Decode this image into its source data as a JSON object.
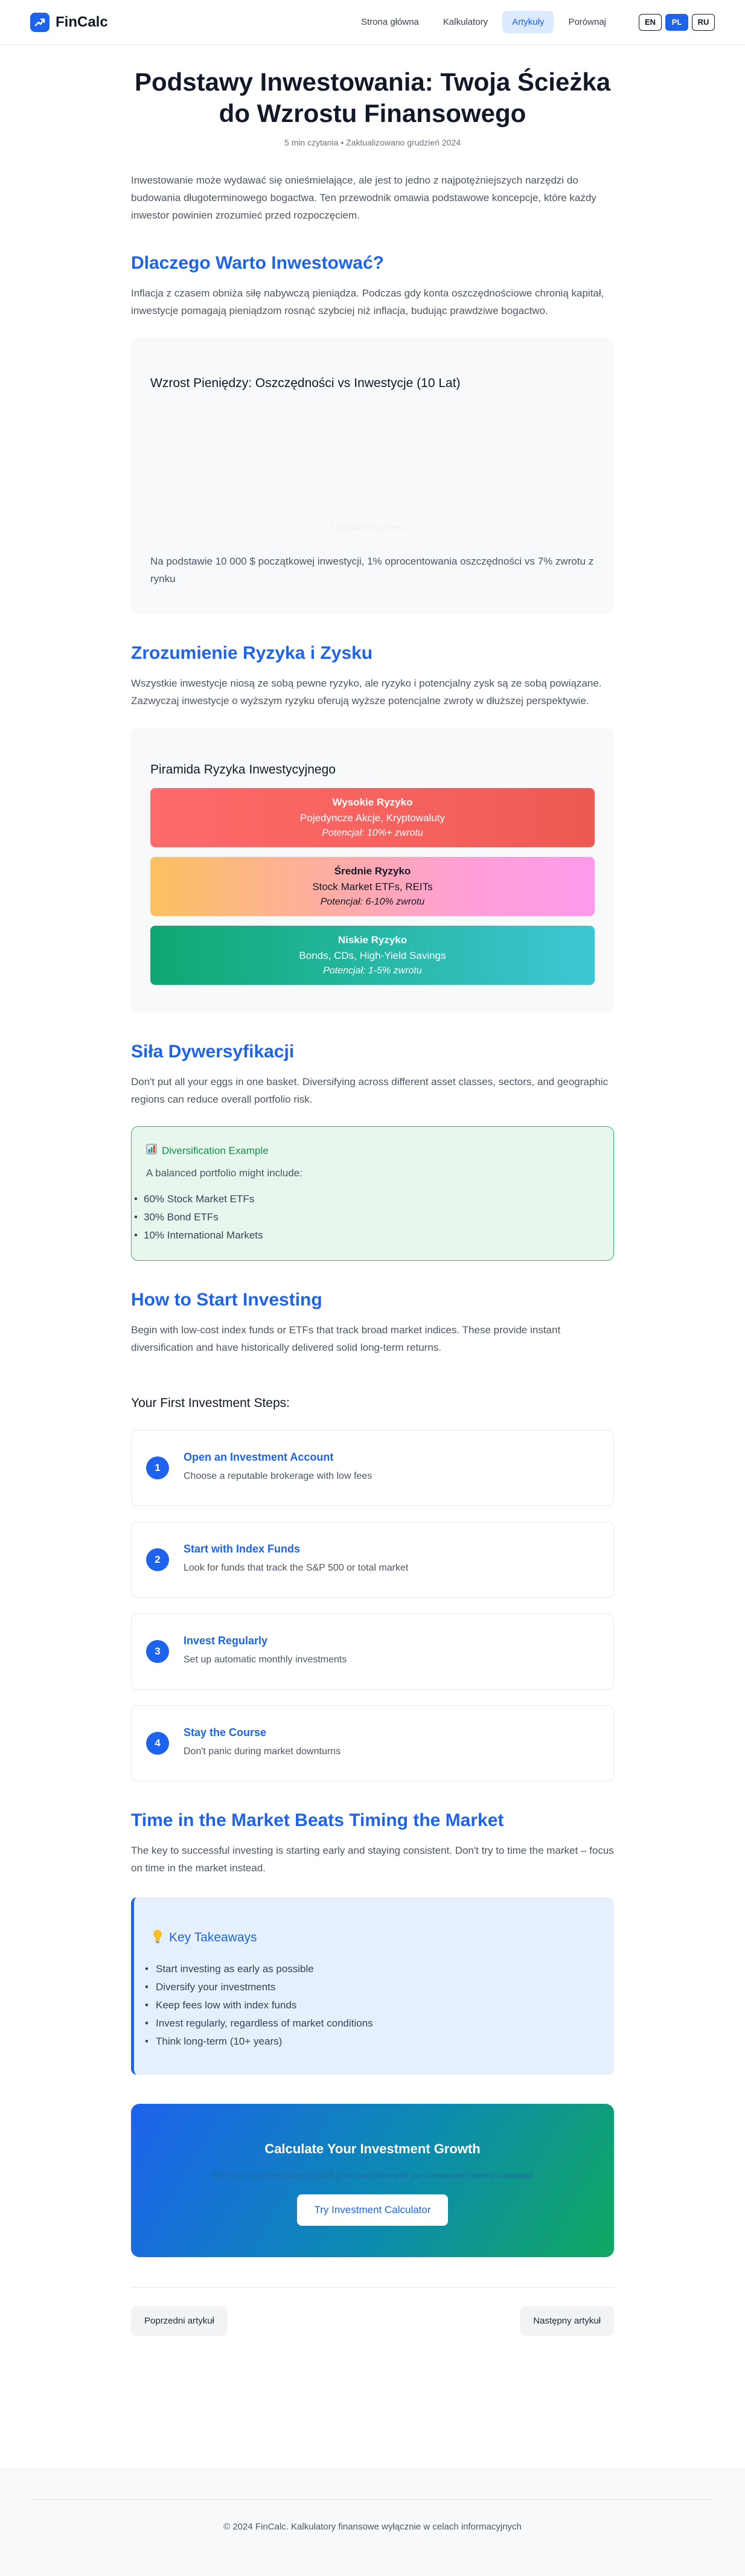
{
  "header": {
    "brand": "FinCalc",
    "nav": [
      {
        "label": "Strona główna"
      },
      {
        "label": "Kalkulatory"
      },
      {
        "label": "Artykuły"
      },
      {
        "label": "Porównaj"
      }
    ],
    "active_nav": "Artykuły",
    "languages": [
      "EN",
      "PL",
      "RU"
    ],
    "active_language": "PL"
  },
  "article": {
    "title": "Podstawy Inwestowania: Twoja Ścieżka do Wzrostu Finansowego",
    "meta": "5 min czytania • Zaktualizowano grudzień 2024",
    "intro": "Inwestowanie może wydawać się onieśmielające, ale jest to jedno z najpotężniejszych narzędzi do budowania długoterminowego bogactwa. Ten przewodnik omawia podstawowe koncepcje, które każdy inwestor powinien zrozumieć przed rozpoczęciem.",
    "why": {
      "heading": "Dlaczego Warto Inwestować?",
      "body": "Inflacja z czasem obniża siłę nabywczą pieniądza. Podczas gdy konta oszczędnościowe chronią kapitał, inwestycje pomagają pieniądzom rosnąć szybciej niż inflacja, budując prawdziwe bogactwo.",
      "chart_title": "Wzrost Pieniędzy: Oszczędności vs Inwestycje (10 Lat)",
      "chart_placeholder": "Ładowanie wykresu...",
      "chart_note": "Na podstawie 10 000 $ początkowej inwestycji, 1% oprocentowania oszczędności vs 7% zwrotu z rynku"
    },
    "risk": {
      "heading": "Zrozumienie Ryzyka i Zysku",
      "body": "Wszystkie inwestycje niosą ze sobą pewne ryzyko, ale ryzyko i potencjalny zysk są ze sobą powiązane. Zazwyczaj inwestycje o wyższym ryzyku oferują wyższe potencjalne zwroty w dłuższej perspektywie.",
      "pyramid_title": "Piramida Ryzyka Inwestycyjnego",
      "levels": [
        {
          "title": "Wysokie Ryzyko",
          "desc": "Pojedyncze Akcje, Kryptowaluty",
          "potential": "Potencjał: 10%+ zwrotu"
        },
        {
          "title": "Średnie Ryzyko",
          "desc": "Stock Market ETFs, REITs",
          "potential": "Potencjał: 6-10% zwrotu"
        },
        {
          "title": "Niskie Ryzyko",
          "desc": "Bonds, CDs, High-Yield Savings",
          "potential": "Potencjał: 1-5% zwrotu"
        }
      ]
    },
    "diversification": {
      "heading": "Siła Dywersyfikacji",
      "body": "Don't put all your eggs in one basket. Diversifying across different asset classes, sectors, and geographic regions can reduce overall portfolio risk.",
      "box_title": "Diversification Example",
      "box_icon": "chart-icon",
      "box_sub": "A balanced portfolio might include:",
      "items": [
        "60% Stock Market ETFs",
        "30% Bond ETFs",
        "10% International Markets"
      ]
    },
    "start": {
      "heading": "How to Start Investing",
      "body": "Begin with low-cost index funds or ETFs that track broad market indices. These provide instant diversification and have historically delivered solid long-term returns.",
      "steps_heading": "Your First Investment Steps:",
      "steps": [
        {
          "num": "1",
          "title": "Open an Investment Account",
          "desc": "Choose a reputable brokerage with low fees"
        },
        {
          "num": "2",
          "title": "Start with Index Funds",
          "desc": "Look for funds that track the S&P 500 or total market"
        },
        {
          "num": "3",
          "title": "Invest Regularly",
          "desc": "Set up automatic monthly investments"
        },
        {
          "num": "4",
          "title": "Stay the Course",
          "desc": "Don't panic during market downturns"
        }
      ]
    },
    "time": {
      "heading": "Time in the Market Beats Timing the Market",
      "body": "The key to successful investing is starting early and staying consistent. Don't try to time the market – focus on time in the market instead.",
      "key_title": "Key Takeaways",
      "key_icon": "lightbulb-icon",
      "takeaways": [
        "Start investing as early as possible",
        "Diversify your investments",
        "Keep fees low with index funds",
        "Invest regularly, regardless of market conditions",
        "Think long-term (10+ years)"
      ]
    },
    "cta": {
      "title": "Calculate Your Investment Growth",
      "subtitle": "See how your investments could grow over time with our compound interest calculator",
      "button": "Try Investment Calculator"
    },
    "pager": {
      "prev": "Poprzedni artykuł",
      "next": "Następny artykuł"
    }
  },
  "footer": {
    "text": "© 2024 FinCalc. Kalkulatory finansowe wyłącznie w celach informacyjnych"
  },
  "colors": {
    "accent": "#1d63ed",
    "high_risk": "#ee5a52",
    "medium_risk": "#fcc160",
    "low_risk": "#0ea871",
    "diversification": "#2fb868"
  }
}
